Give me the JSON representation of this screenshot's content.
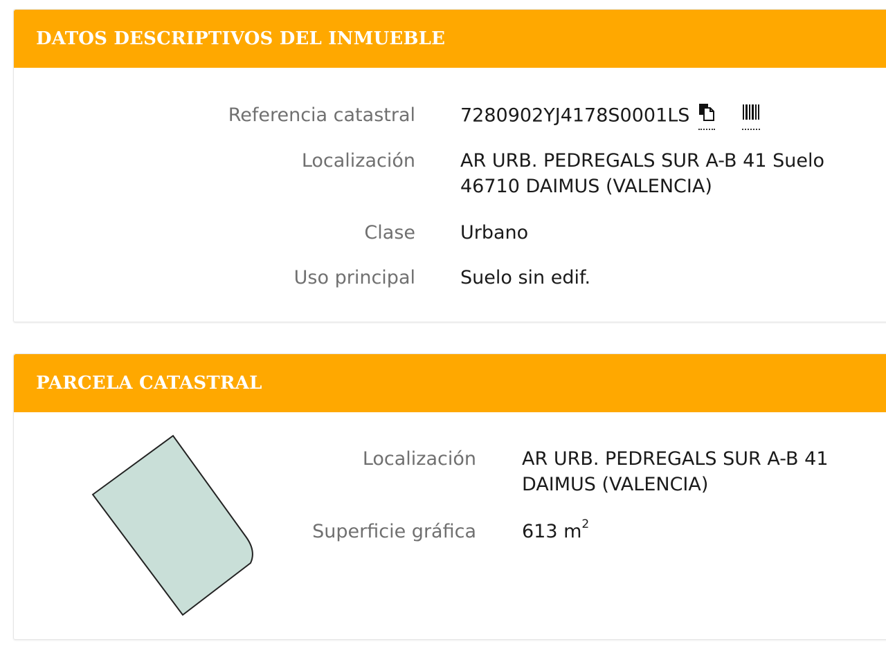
{
  "descriptive": {
    "title": "DATOS DESCRIPTIVOS DEL INMUEBLE",
    "ref_label": "Referencia catastral",
    "ref_value": "7280902YJ4178S0001LS",
    "loc_label": "Localización",
    "loc_line1": "AR URB. PEDREGALS SUR A-B 41 Suelo",
    "loc_line2": "46710 DAIMUS (VALENCIA)",
    "clase_label": "Clase",
    "clase_value": "Urbano",
    "uso_label": "Uso principal",
    "uso_value": "Suelo sin edif."
  },
  "parcel": {
    "title": "PARCELA CATASTRAL",
    "loc_label": "Localización",
    "loc_line1": "AR URB. PEDREGALS SUR A-B 41",
    "loc_line2": "DAIMUS (VALENCIA)",
    "area_label": "Superficie gráfica",
    "area_value": "613 m",
    "area_unit_exp": "2"
  },
  "colors": {
    "header": "#ffa800",
    "parcel_fill": "#c9dfd8",
    "label_text": "#707070",
    "value_text": "#1a1a1a"
  },
  "icons": [
    "copy-icon",
    "barcode-icon"
  ]
}
